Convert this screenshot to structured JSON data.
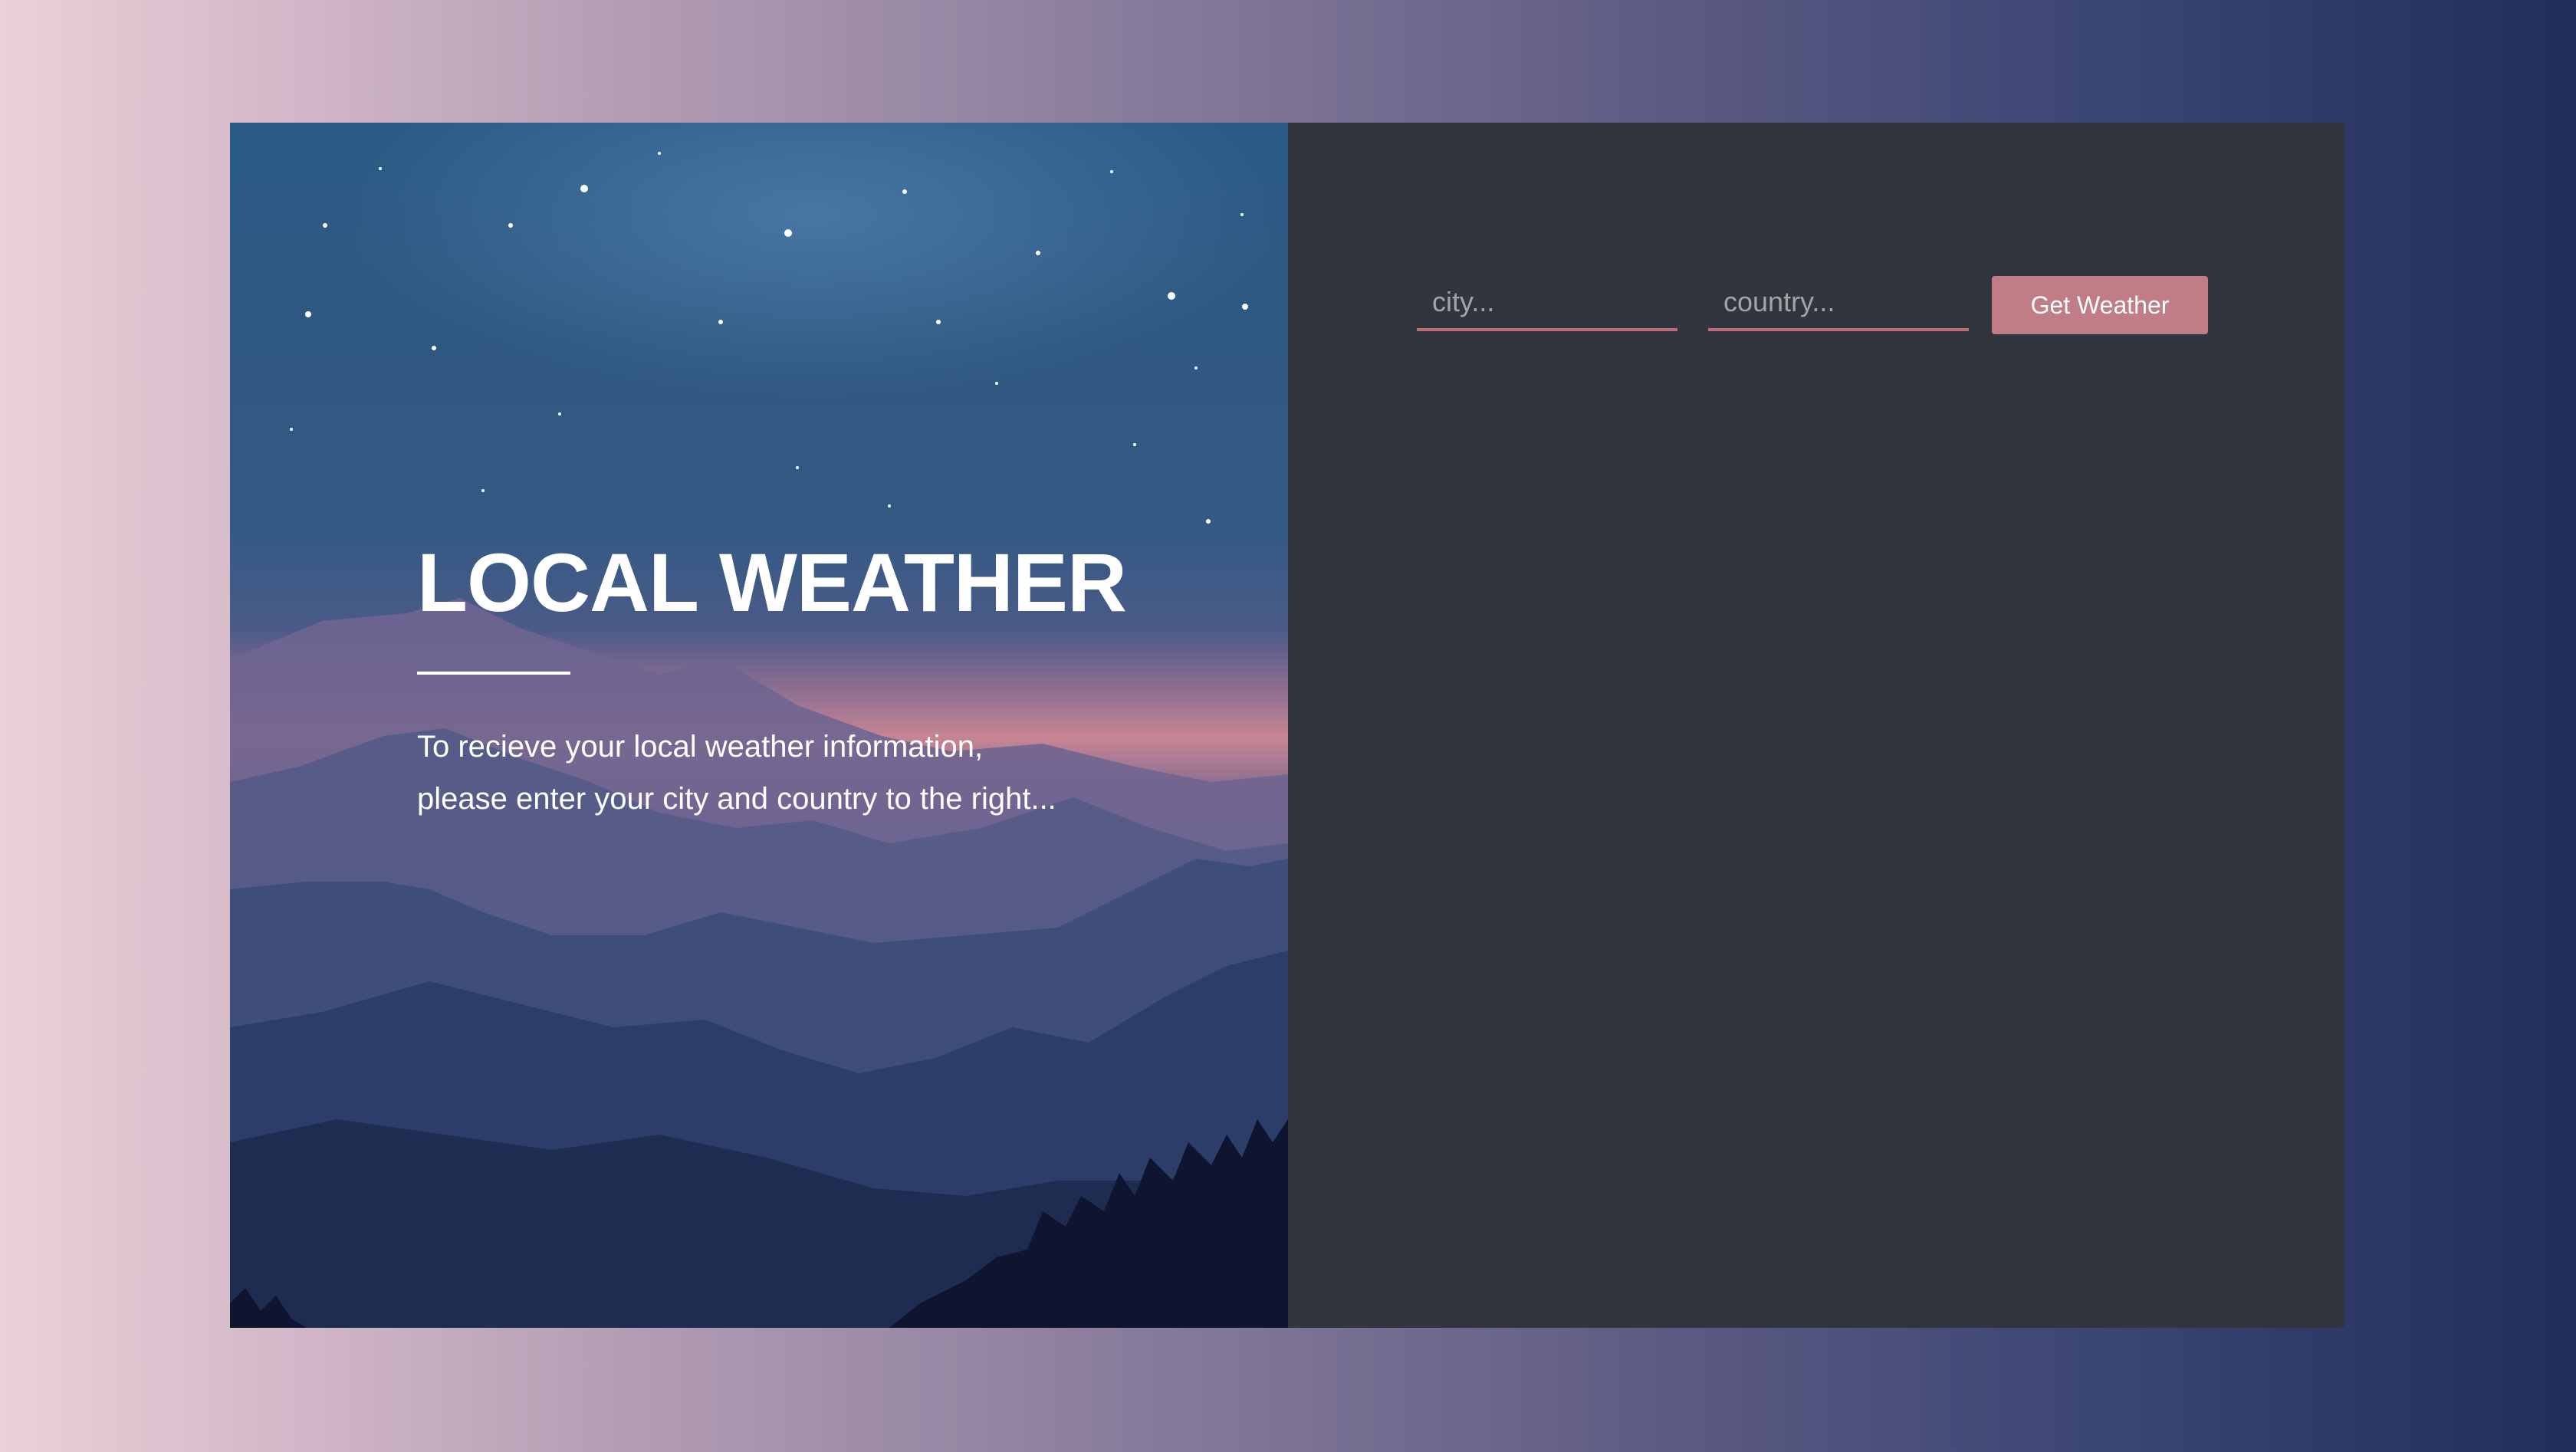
{
  "hero": {
    "title": "LOCAL WEATHER",
    "body_line_1": "To recieve your local weather information,",
    "body_line_2": "please enter your city and country to the right..."
  },
  "form": {
    "city_placeholder": "city...",
    "city_value": "",
    "country_placeholder": "country...",
    "country_value": "",
    "submit_label": "Get Weather"
  },
  "colors": {
    "panel_bg": "#31353d",
    "accent": "#c07d86",
    "input_underline": "#b86f78"
  }
}
